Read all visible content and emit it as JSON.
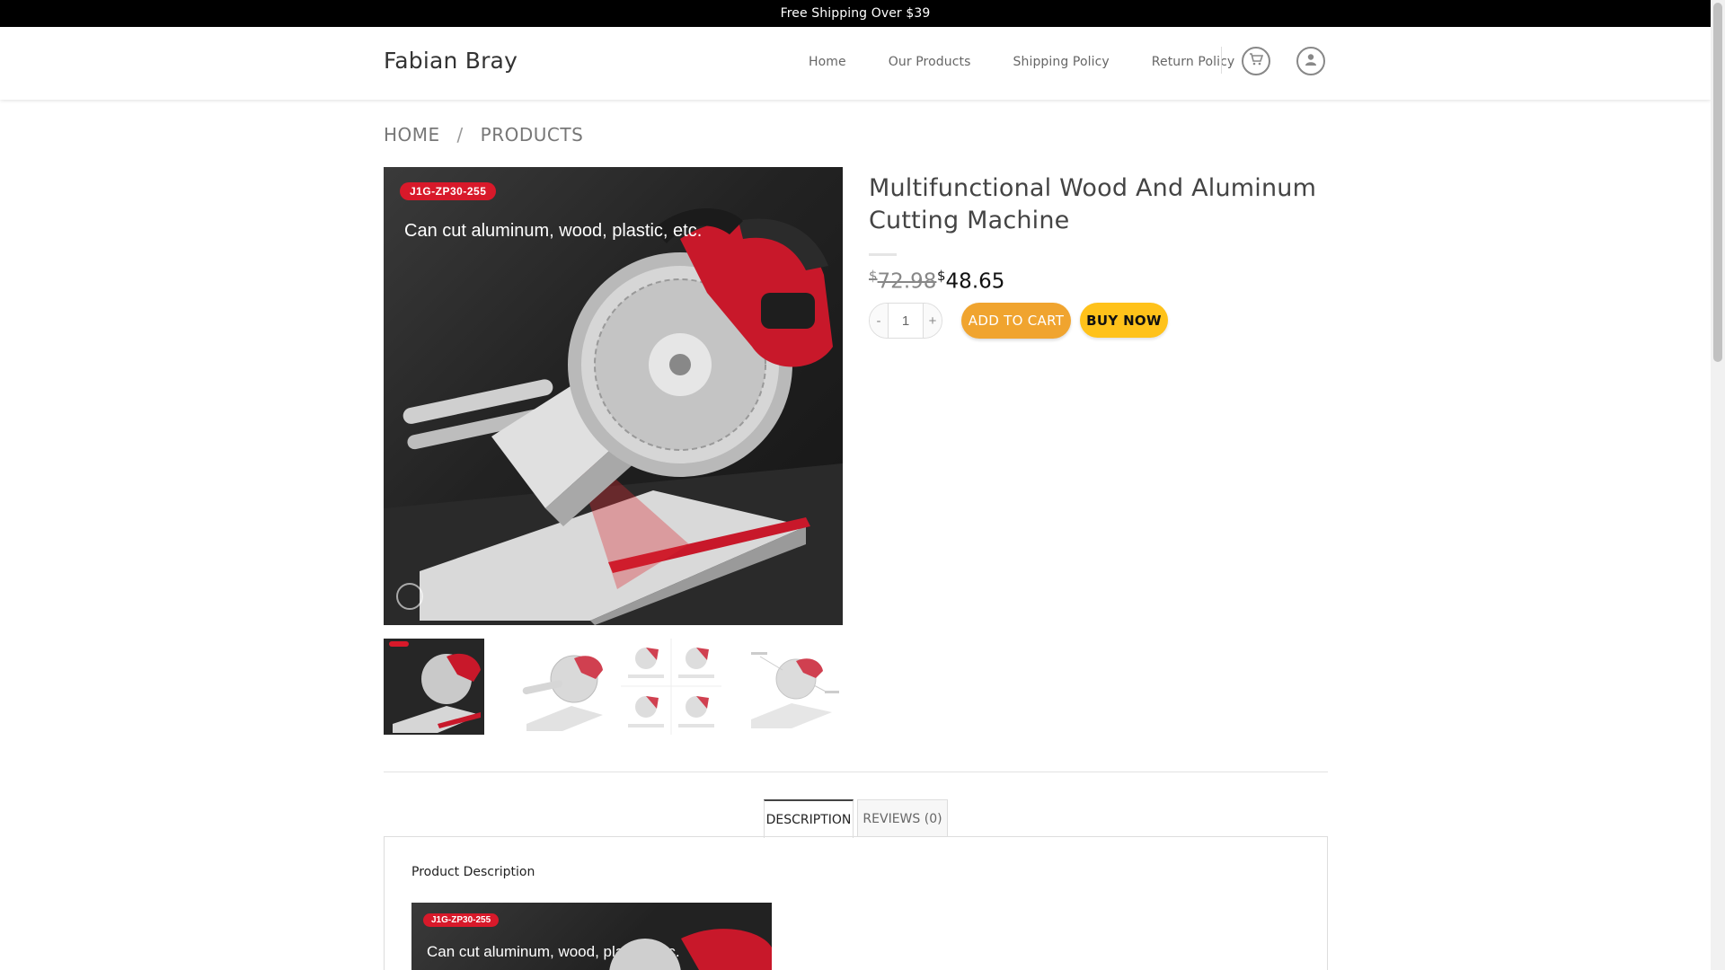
{
  "topbar": {
    "text": "Free Shipping Over $39"
  },
  "header": {
    "logo": "Fabian Bray",
    "nav": [
      "Home",
      "Our Products",
      "Shipping Policy",
      "Return Policy"
    ],
    "cart_icon": "cart-icon",
    "account_icon": "user-icon"
  },
  "breadcrumb": {
    "home": "HOME",
    "sep": "/",
    "current": "PRODUCTS"
  },
  "product": {
    "title": "Multifunctional Wood And Aluminum Cutting Machine",
    "currency": "$",
    "price_old": "72.98",
    "price_new": "48.65",
    "qty_minus": "-",
    "qty_value": "1",
    "qty_plus": "+",
    "add_to_cart": "ADD TO CART",
    "buy_now": "BUY NOW",
    "image_badge": "J1G-ZP30-255",
    "image_caption": "Can cut aluminum, wood, plastic, etc."
  },
  "tabs": {
    "description": "DESCRIPTION",
    "reviews": "REVIEWS (0)"
  },
  "panel": {
    "title": "Product Description"
  },
  "colors": {
    "accent_orange": "#f0a42f",
    "buy_yellow": "#ffc21a",
    "badge_red": "#d8192a"
  }
}
